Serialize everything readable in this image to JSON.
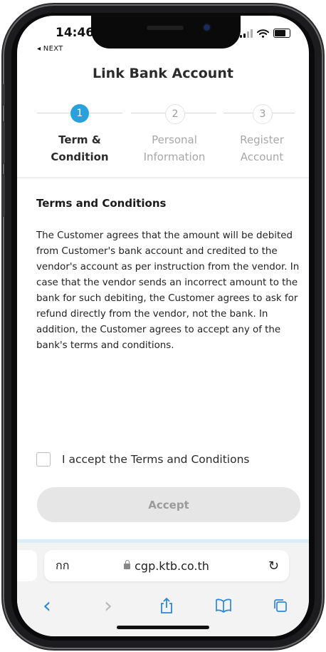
{
  "status": {
    "time": "14:46",
    "back_label": "◂ NEXT"
  },
  "header": {
    "title": "Link Bank Account"
  },
  "steps": [
    {
      "number": "1",
      "line1": "Term &",
      "line2": "Condition",
      "state": "active"
    },
    {
      "number": "2",
      "line1": "Personal",
      "line2": "Information",
      "state": "inactive"
    },
    {
      "number": "3",
      "line1": "Register",
      "line2": "Account",
      "state": "inactive"
    }
  ],
  "terms": {
    "heading": "Terms and Conditions",
    "body": "The Customer agrees that the amount will be debited from Customer's bank account and credited to the vendor's account as per instruction from the vendor. In case that the vendor sends an incorrect amount to the bank for such debiting, the Customer agrees to ask for refund directly from the vendor, not the bank. In addition, the Customer agrees to accept any of the bank's terms and conditions."
  },
  "accept": {
    "checkbox_label": "I accept the Terms and Conditions",
    "checked": false,
    "button_label": "Accept"
  },
  "browser": {
    "aa_label": "กก",
    "url": "cgp.ktb.co.th",
    "reload_icon": "↻"
  },
  "toolbar": {
    "back": "‹",
    "forward": "›",
    "share": "⇧",
    "bookmarks": "▢▢",
    "tabs": "⧉"
  },
  "colors": {
    "accent": "#2aa0dc",
    "disabled_button": "#e6e6e6",
    "ios_blue": "#2f86d4"
  }
}
